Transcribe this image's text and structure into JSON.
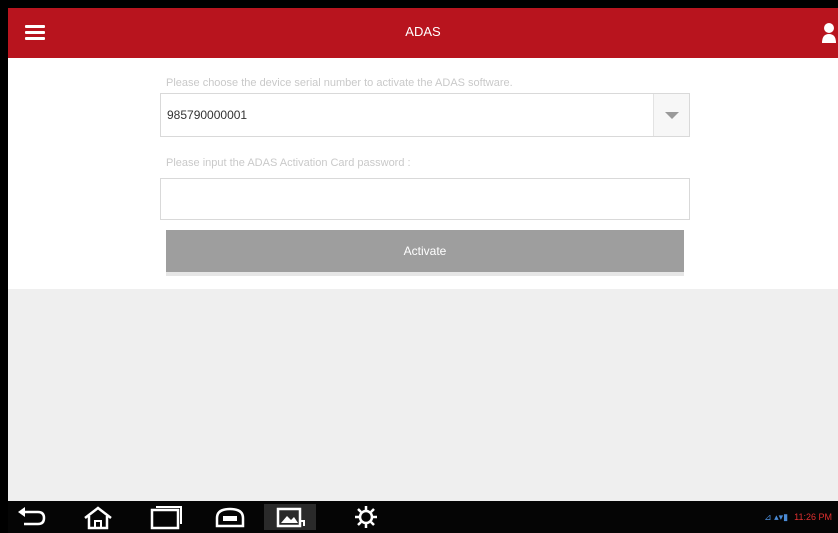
{
  "header": {
    "title": "ADAS",
    "menu_icon": "hamburger-menu-icon",
    "user_icon": "user-icon",
    "color": "#b8141e"
  },
  "form": {
    "serial_prompt": "Please choose the device serial number to activate the ADAS software.",
    "serial_value": "985790000001",
    "password_prompt": "Please input the ADAS Activation Card password :",
    "password_value": "",
    "activate_label": "Activate"
  },
  "navbar": {
    "icons": [
      "back-icon",
      "home-icon",
      "recent-apps-icon",
      "vci-icon",
      "screenshot-icon",
      "settings-icon"
    ],
    "time": "11:26 PM"
  }
}
